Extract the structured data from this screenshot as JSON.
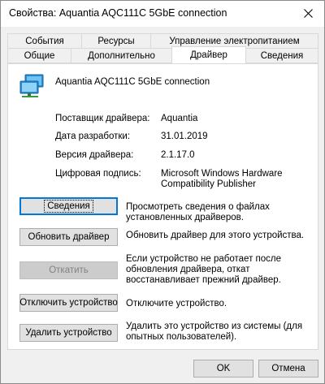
{
  "window": {
    "title": "Свойства: Aquantia AQC111C 5GbE connection"
  },
  "tabs_row1": [
    {
      "label": "События"
    },
    {
      "label": "Ресурсы"
    },
    {
      "label": "Управление электропитанием"
    }
  ],
  "tabs_row2": [
    {
      "label": "Общие"
    },
    {
      "label": "Дополнительно"
    },
    {
      "label": "Драйвер",
      "active": true
    },
    {
      "label": "Сведения"
    }
  ],
  "device": {
    "name": "Aquantia AQC111C 5GbE connection",
    "icon": "network-adapter-icon"
  },
  "properties": {
    "provider_label": "Поставщик драйвера:",
    "provider_value": "Aquantia",
    "date_label": "Дата разработки:",
    "date_value": "31.01.2019",
    "version_label": "Версия драйвера:",
    "version_value": "2.1.17.0",
    "signer_label": "Цифровая подпись:",
    "signer_value_line1": "Microsoft Windows Hardware",
    "signer_value_line2": "Compatibility Publisher"
  },
  "actions": {
    "details_label": "Сведения",
    "details_desc": "Просмотреть сведения о файлах установленных драйверов.",
    "update_label": "Обновить драйвер",
    "update_desc": "Обновить драйвер для этого устройства.",
    "rollback_label": "Откатить",
    "rollback_desc": "Если устройство не работает после обновления драйвера, откат восстанавливает прежний драйвер.",
    "disable_label": "Отключить устройство",
    "disable_desc": "Отключите устройство.",
    "uninstall_label": "Удалить устройство",
    "uninstall_desc": "Удалить это устройство из системы (для опытных пользователей)."
  },
  "footer": {
    "ok_label": "OK",
    "cancel_label": "Отмена"
  },
  "colors": {
    "focus_accent": "#0078d7",
    "button_face": "#e1e1e1",
    "dialog_background": "#f0f0f0"
  }
}
